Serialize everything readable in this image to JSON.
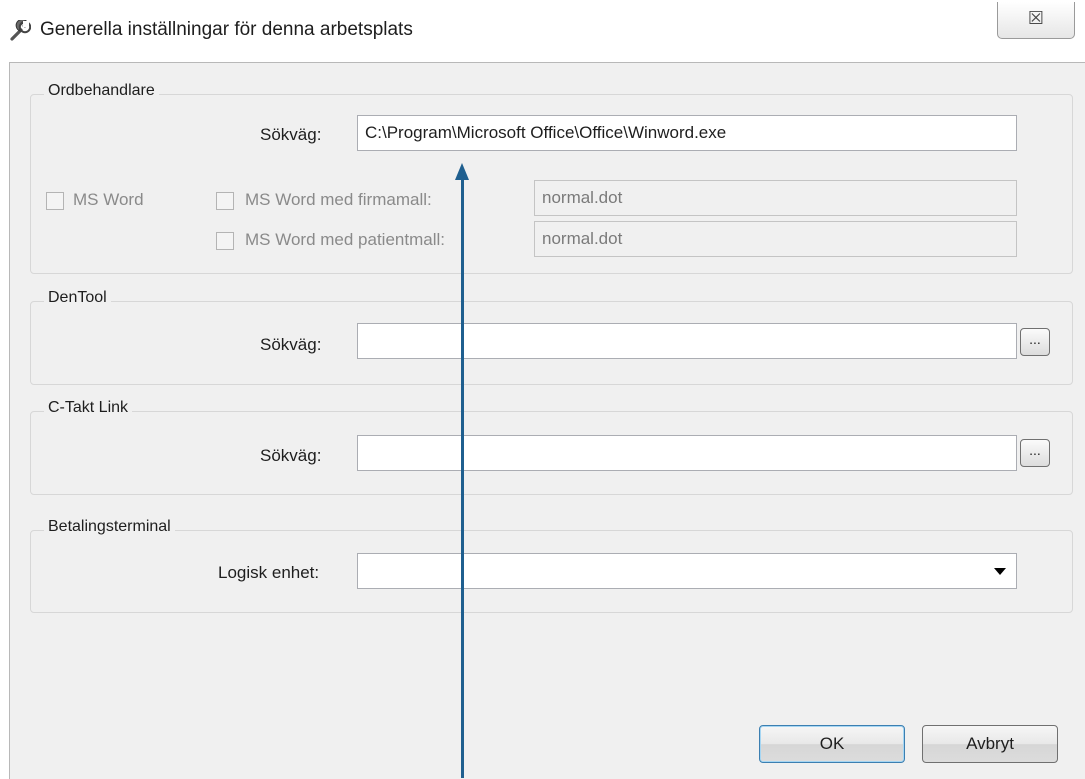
{
  "window": {
    "title": "Generella inställningar för denna arbetsplats",
    "title_icon": "wrench-icon",
    "close_symbol": "☒"
  },
  "ordbehandlare": {
    "legend": "Ordbehandlare",
    "path_label": "Sökväg:",
    "path_value": "C:\\Program\\Microsoft Office\\Office\\Winword.exe",
    "ms_word_label": "MS Word",
    "ms_word_checked": false,
    "firmamall_label": "MS Word med firmamall:",
    "firmamall_checked": false,
    "firmamall_value": "normal.dot",
    "patientmall_label": "MS Word med patientmall:",
    "patientmall_checked": false,
    "patientmall_value": "normal.dot"
  },
  "dentool": {
    "legend": "DenTool",
    "path_label": "Sökväg:",
    "path_value": "",
    "browse_label": "..."
  },
  "ctakt": {
    "legend": "C-Takt Link",
    "path_label": "Sökväg:",
    "path_value": "",
    "browse_label": "..."
  },
  "betalingsterminal": {
    "legend": "Betalingsterminal",
    "device_label": "Logisk enhet:",
    "device_value": ""
  },
  "buttons": {
    "ok": "OK",
    "cancel": "Avbryt"
  },
  "colors": {
    "annotation_arrow": "#1f5f8f",
    "dialog_background": "#f0f0f0"
  }
}
